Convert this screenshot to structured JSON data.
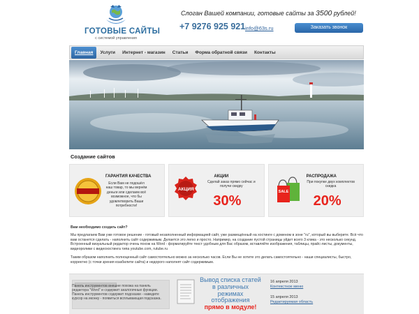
{
  "header": {
    "logo_title": "ГОТОВЫЕ САЙТЫ",
    "logo_subtitle": "с системой управления",
    "slogan": "Слоган Вашей компании, готовые сайты за",
    "slogan_price": "3500",
    "slogan_tail": "рублей!",
    "phone": "+7 9276 925 921",
    "email": "info@63s.ru",
    "call_button": "Заказать звонок"
  },
  "nav": {
    "items": [
      {
        "label": "Главная"
      },
      {
        "label": "Услуги"
      },
      {
        "label": "Интернет - магазин"
      },
      {
        "label": "Статьи"
      },
      {
        "label": "Форма обратной связи"
      },
      {
        "label": "Контакты"
      }
    ]
  },
  "main": {
    "section_title": "Создание сайтов",
    "cards": [
      {
        "title": "ГАРАНТИЯ КАЧЕСТВА",
        "text": "Если Вам не подошёл наш товар, то мы вернём деньги или сделаем всё возможное, что бы удовлетворить Ваши потребности!",
        "badge": "GUARANTEE QUALITY"
      },
      {
        "title": "АКЦИИ",
        "text": "Сделай заказ прямо сейчас и получи скидку",
        "value": "30%",
        "badge": "АКЦИЯ"
      },
      {
        "title": "РАСПРОДАЖА",
        "text": "При покупке двух комплектов скидка",
        "value": "20%",
        "badge": "SALE"
      }
    ],
    "question": "Вам необходимо создать сайт?",
    "paragraph_1": "Мы предлагаем Вам уже готовое решение - готовый незаполненный информацией сайт, уже размещённый на хостинге с доменом в зоне \"ru\", который вы выберите. Всё что вам останется сделать - наполнить сайт содержимым. Делается это легко и просто. Например, на создание пустой страницы уйдет всего 3 клика - это несколько секунд. Встроенный визуальный редактор очень похож на Word - форматируйте текст удобным для Вас образом, вставляйте изображения, таблицы, прайс-листы, документы, видеоролики с видеохостинга типа youtube.com, rutube.ru",
    "paragraph_2": "Таким образом наполнить полноценный сайт самостоятельно можно за несколько часов. Если Вы не хотите это делать самостоятельно - наши специалисты, быстро, корректно (с точки зрения юзабилити сайта) и недорого наполнят сайт содержимым."
  },
  "bottom": {
    "left_text": "Панель инструментов внешне похожа на панель редактора \"Word\" и содержит аналогичные функции. Панель инструментов содержит подсказки - наведите курсор на иконку - появиться всплывающая подсказка.",
    "mid_line1": "Вывод списка статей",
    "mid_line2": "в различных режимах",
    "mid_line3": "отображения",
    "mid_line4": "прямо в модуле!",
    "news": [
      {
        "date": "16 апреля 2013",
        "link": "Контекстное меню"
      },
      {
        "date": "15 апреля 2013",
        "link": "Редактируемая область"
      }
    ]
  },
  "colors": {
    "accent_blue": "#2d66a3",
    "promo_red": "#e8241d"
  }
}
